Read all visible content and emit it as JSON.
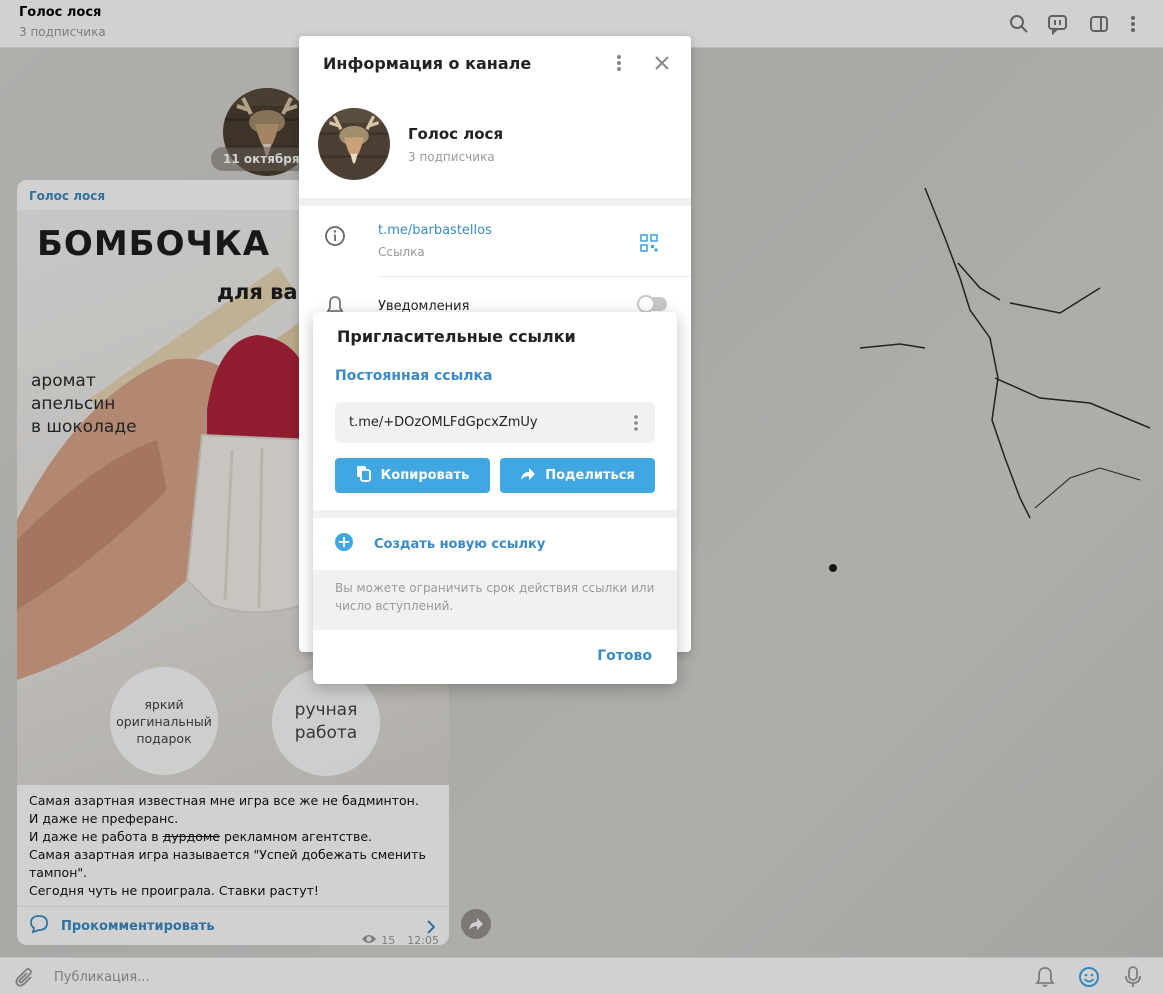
{
  "header": {
    "title": "Голос лося",
    "subtitle": "3 подписчика",
    "icons": [
      "search-icon",
      "discussion-icon",
      "sidebar-toggle-icon",
      "more-vertical-icon"
    ]
  },
  "chat": {
    "date_label": "11 октября 2",
    "message": {
      "author": "Голос лося",
      "image": {
        "title": "БОМБОЧКА",
        "subtitle": "для ва",
        "aroma": "аромат\nапельсин\nв шоколаде",
        "circle_left": "яркий\nоригинальный\nподарок",
        "circle_right": "ручная\nработа"
      },
      "lines": [
        "Самая азартная известная мне игра все же не бадминтон.",
        "И даже не преферанс.",
        "И даже не работа в",
        "дурдоме",
        " рекламном агентстве.",
        "Самая азартная игра называется \"Успей добежать сменить тампон\".",
        "Сегодня чуть не проиграла. Ставки растут!"
      ],
      "views": "15",
      "time": "12:05",
      "comment_label": "Прокомментировать"
    }
  },
  "composer": {
    "placeholder": "Публикация..."
  },
  "channel_info": {
    "title": "Информация о канале",
    "name": "Голос лося",
    "subscribers": "3 подписчика",
    "link": "t.me/barbastellos",
    "link_label": "Ссылка",
    "notifications_label": "Уведомления"
  },
  "invite_dialog": {
    "title": "Пригласительные ссылки",
    "section": "Постоянная ссылка",
    "link": "t.me/+DOzOMLFdGpcxZmUy",
    "copy_label": "Копировать",
    "share_label": "Поделиться",
    "create_label": "Создать новую ссылку",
    "hint": "Вы можете ограничить срок действия ссылки или число вступлений.",
    "done_label": "Готово"
  },
  "colors": {
    "accent": "#40a7e3",
    "link": "#3a8ac3",
    "muted": "#999999"
  }
}
